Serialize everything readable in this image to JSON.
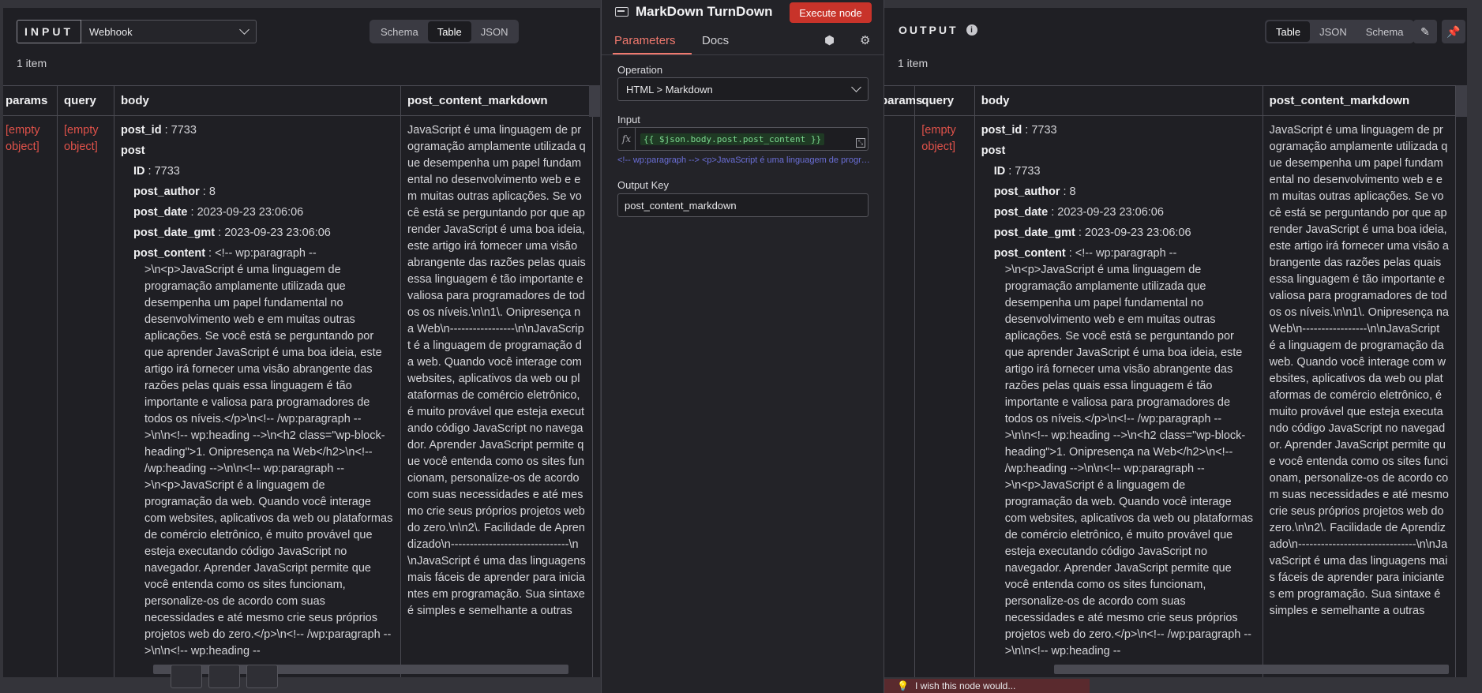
{
  "input_panel": {
    "label": "INPUT",
    "source": "Webhook",
    "view_tabs": [
      "Schema",
      "Table",
      "JSON"
    ],
    "active_tab": "Table",
    "item_count": "1 item",
    "columns": [
      "params",
      "query",
      "body",
      "post_content_markdown"
    ],
    "params_value_1": "[empty",
    "params_value_2": "object]",
    "query_value_1": "[empty",
    "query_value_2": "object]"
  },
  "body": {
    "post_id_key": "post_id",
    "post_id_val": " : 7733",
    "post_key": "post",
    "id_key": "ID",
    "id_val": " : 7733",
    "author_key": "post_author",
    "author_val": " : 8",
    "date_key": "post_date",
    "date_val": " : 2023-09-23 23:06:06",
    "date_gmt_key": "post_date_gmt",
    "date_gmt_val": " : 2023-09-23 23:06:06",
    "content_key": "post_content",
    "content_val_first": " : <!-- wp:paragraph --",
    "content_val": ">\\n<p>JavaScript é uma linguagem de programação amplamente utilizada que desempenha um papel fundamental no desenvolvimento web e em muitas outras aplicações. Se você está se perguntando por que aprender JavaScript é uma boa ideia, este artigo irá fornecer uma visão abrangente das razões pelas quais essa linguagem é tão importante e valiosa para programadores de todos os níveis.</p>\\n<!-- /wp:paragraph -->\\n\\n<!-- wp:heading -->\\n<h2 class=\"wp-block-heading\">1. Onipresença na Web</h2>\\n<!-- /wp:heading -->\\n\\n<!-- wp:paragraph -->\\n<p>JavaScript é a linguagem de programação da web. Quando você interage com websites, aplicativos da web ou plataformas de comércio eletrônico, é muito provável que esteja executando código JavaScript no navegador. Aprender JavaScript permite que você entenda como os sites funcionam, personalize-os de acordo com suas necessidades e até mesmo crie seus próprios projetos web do zero.</p>\\n<!--\n/wp:paragraph -->\\n\\n<!-- wp:heading --"
  },
  "markdown_text": "JavaScript é uma linguagem de programação amplamente utilizada que desempenha um papel fundamental no desenvolvimento web e em muitas outras aplicações. Se você está se perguntando por que aprender JavaScript é uma boa ideia, este artigo irá fornecer uma visão abrangente das razões pelas quais essa linguagem é tão importante e valiosa para programadores de todos os níveis.\\n\\n1\\. Onipresença na Web\\n-----------------\\n\\nJavaScript é a linguagem de programação da web. Quando você interage com websites, aplicativos da web ou plataformas de comércio eletrônico, é muito provável que esteja executando código JavaScript no navegador. Aprender JavaScript permite que você entenda como os sites funcionam, personalize-os de acordo com suas necessidades e até mesmo crie seus próprios projetos web do zero.\\n\\n2\\. Facilidade de Aprendizado\\n-------------------------------\\n\\nJavaScript é uma das linguagens mais fáceis de aprender para iniciantes em programação. Sua sintaxe é simples e semelhante a outras",
  "node": {
    "title": "MarkDown TurnDown",
    "execute_label": "Execute node",
    "tabs": [
      "Parameters",
      "Docs"
    ],
    "operation_label": "Operation",
    "operation_value": "HTML > Markdown",
    "input_label": "Input",
    "fx": "fx",
    "expression": "{{ $json.body.post.post_content }}",
    "expression_preview": "<!-- wp:paragraph --> <p>JavaScript é uma linguagem de programação amplamente",
    "output_key_label": "Output Key",
    "output_key_value": "post_content_markdown"
  },
  "output_panel": {
    "label": "OUTPUT",
    "view_tabs": [
      "Table",
      "JSON",
      "Schema"
    ],
    "active_tab": "Table",
    "item_count": "1 item",
    "columns": [
      "params",
      "query",
      "body",
      "post_content_markdown"
    ],
    "query_value_1": "[empty",
    "query_value_2": "object]"
  },
  "footer": {
    "tip": "I wish this node would..."
  },
  "colors": {
    "accent": "#f0796e",
    "execute": "#c8332a",
    "empty_value": "#e0524a",
    "expression_preview": "#6b6fd8"
  },
  "icons": [
    "chevron-down-icon",
    "info-icon",
    "pencil-icon",
    "pin-icon",
    "cube-icon",
    "gear-icon",
    "node-terminal-icon",
    "expand-icon",
    "lightbulb-icon"
  ]
}
